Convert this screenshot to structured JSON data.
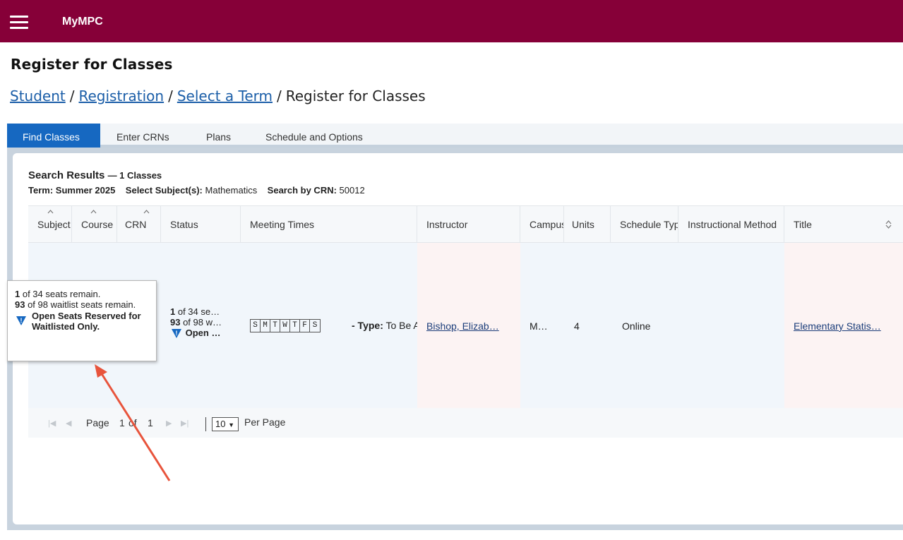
{
  "app": {
    "title": "MyMPC",
    "brand_color": "#860038"
  },
  "page": {
    "title": "Register for Classes"
  },
  "breadcrumb": {
    "student": "Student",
    "registration": "Registration",
    "select_term": "Select a Term",
    "current": "Register for Classes",
    "separator": "/"
  },
  "tabs": {
    "find_classes": "Find Classes",
    "enter_crns": "Enter CRNs",
    "plans": "Plans",
    "schedule_options": "Schedule and Options"
  },
  "search_results": {
    "title": "Search Results",
    "count": "— 1 Classes",
    "term_label": "Term:",
    "term_value": "Summer 2025",
    "subject_label": "Select Subject(s):",
    "subject_value": "Mathematics",
    "crn_label": "Search by CRN:",
    "crn_value": "50012"
  },
  "table": {
    "headers": {
      "subject": "Subject",
      "course": "Course",
      "crn": "CRN",
      "status": "Status",
      "meeting_times": "Meeting Times",
      "instructor": "Instructor",
      "campus": "Campus",
      "units": "Units",
      "schedule_type": "Schedule Type",
      "instructional_method": "Instructional Method",
      "title": "Title"
    },
    "row": {
      "status_seats_num": "1",
      "status_seats_text": " of 34 se…",
      "status_wait_num": "93",
      "status_wait_text": " of 98 w…",
      "status_open": "Open …",
      "days": [
        "S",
        "M",
        "T",
        "W",
        "T",
        "F",
        "S"
      ],
      "type_label": "- Type:",
      "type_value": " To Be A",
      "instructor": "Bishop, Elizab…",
      "campus": "M…",
      "units": "4",
      "schedule_type": "Online",
      "title": "Elementary Statis…"
    }
  },
  "pager": {
    "page_label": "Page",
    "current_page": "1",
    "of_label": "of",
    "total_pages": "1",
    "per_page_value": "10",
    "per_page_label": "Per Page"
  },
  "tooltip": {
    "seats_num": "1",
    "seats_text": " of 34 seats remain.",
    "wait_num": "93",
    "wait_text": " of 98 waitlist seats remain.",
    "reserved": "Open Seats Reserved for Waitlisted Only."
  },
  "annotation_color": "#e8543c"
}
